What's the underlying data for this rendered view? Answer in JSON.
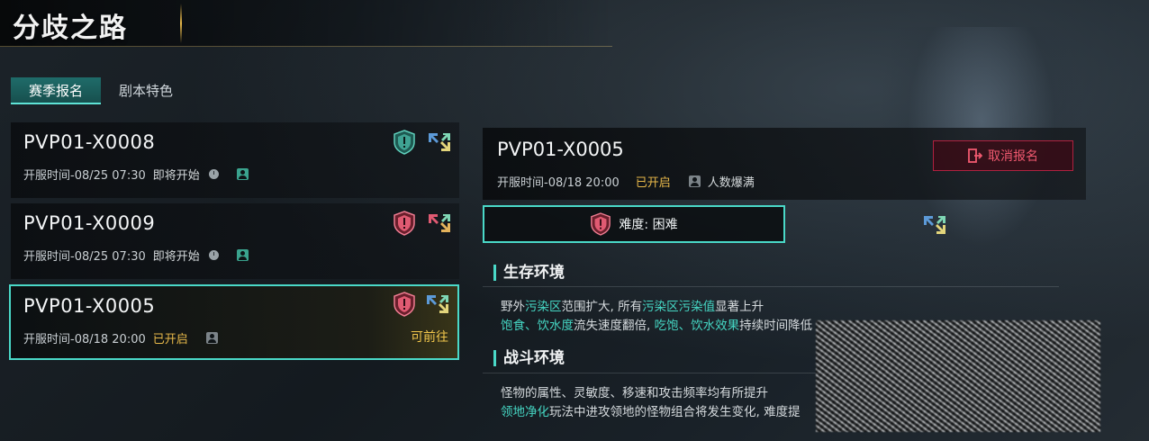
{
  "header": {
    "title": "分歧之路"
  },
  "tabs": [
    {
      "label": "赛季报名",
      "active": true
    },
    {
      "label": "剧本特色",
      "active": false
    }
  ],
  "servers": [
    {
      "name": "PVP01-X0008",
      "time": "开服时间-08/25 07:30",
      "status": "即将开始",
      "shield_color": "#3fa393",
      "selected": false
    },
    {
      "name": "PVP01-X0009",
      "time": "开服时间-08/25 07:30",
      "status": "即将开始",
      "shield_color": "#e05a72",
      "selected": false
    },
    {
      "name": "PVP01-X0005",
      "time": "开服时间-08/18 20:00",
      "status": "已开启",
      "shield_color": "#e05a72",
      "selected": true,
      "action": "可前往"
    }
  ],
  "detail": {
    "name": "PVP01-X0005",
    "time": "开服时间-08/18 20:00",
    "status": "已开启",
    "crowd": "人数爆满",
    "cancel_label": "取消报名",
    "difficulty": "难度: 困难",
    "sections": [
      {
        "title": "生存环境",
        "line1": {
          "a": "野外",
          "b": "污染区",
          "c": "范围扩大, 所有",
          "d": "污染区污染值",
          "e": "显著上升"
        },
        "line2": {
          "a": "饱食、饮水度",
          "b": "流失速度翻倍, ",
          "c": "吃饱、饮水效果",
          "d": "持续时间降低"
        }
      },
      {
        "title": "战斗环境",
        "line1": {
          "a": "怪物的属性、灵敏度、移速和攻击频率均有所提升"
        },
        "line2": {
          "a": "领地净化",
          "b": "玩法中进攻领地的怪物组合将发生变化, 难度",
          "c": "提"
        }
      }
    ]
  },
  "colors": {
    "accent": "#4ad9c8",
    "gold": "#e8b94a",
    "danger": "#e05a72"
  }
}
